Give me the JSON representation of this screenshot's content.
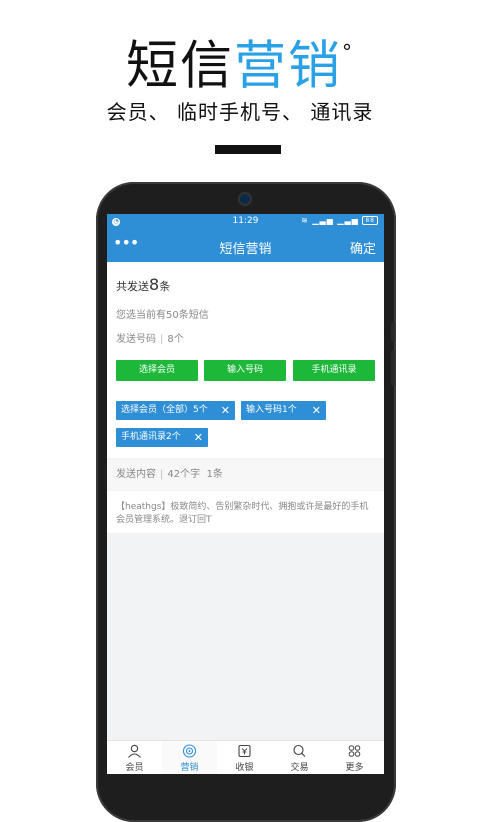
{
  "promo": {
    "title_dark": "短信",
    "title_blue": "营销",
    "title_mark": "°",
    "subtitle": "会员、 临时手机号、 通讯录"
  },
  "status_bar": {
    "time": "11:29",
    "battery": "88"
  },
  "app_bar": {
    "menu": "•••",
    "title": "短信营销",
    "confirm": "确定"
  },
  "summary": {
    "total_prefix": "共发送",
    "total_count": "8",
    "total_suffix": "条",
    "remaining": "您选当前有50条短信",
    "send_numbers_label": "发送号码",
    "send_numbers_count": "8个"
  },
  "buttons": {
    "select_members": "选择会员",
    "enter_number": "输入号码",
    "phone_contacts": "手机通讯录"
  },
  "chips": [
    {
      "label": "选择会员（全部）5个",
      "close": "✕"
    },
    {
      "label": "输入号码1个",
      "close": "✕"
    },
    {
      "label": "手机通讯录2个",
      "close": "✕"
    }
  ],
  "content": {
    "label": "发送内容",
    "char_count": "42个字",
    "sms_count": "1条",
    "message": "【heathgs】极致简约、告别繁杂时代、拥抱或许是最好的手机会员管理系统。退订回T"
  },
  "tabs": [
    {
      "label": "会员",
      "icon": "person-icon"
    },
    {
      "label": "营销",
      "icon": "target-icon",
      "active": true
    },
    {
      "label": "收银",
      "icon": "cashier-icon"
    },
    {
      "label": "交易",
      "icon": "search-icon"
    },
    {
      "label": "更多",
      "icon": "grid-icon"
    }
  ],
  "colors": {
    "primary": "#2f8fd6",
    "green": "#1db83a",
    "title_blue": "#2aa0e6"
  }
}
